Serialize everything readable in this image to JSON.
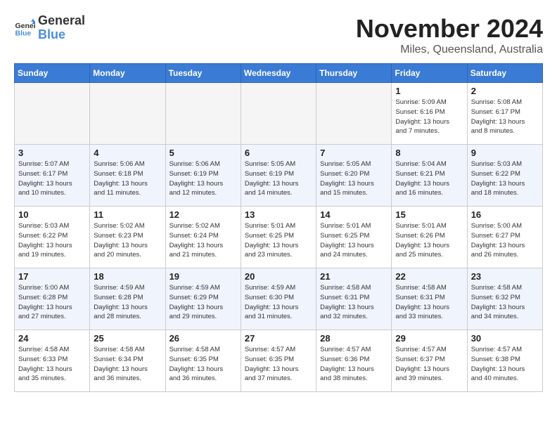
{
  "logo": {
    "general": "General",
    "blue": "Blue"
  },
  "header": {
    "month": "November 2024",
    "location": "Miles, Queensland, Australia"
  },
  "weekdays": [
    "Sunday",
    "Monday",
    "Tuesday",
    "Wednesday",
    "Thursday",
    "Friday",
    "Saturday"
  ],
  "weeks": [
    [
      {
        "day": "",
        "info": ""
      },
      {
        "day": "",
        "info": ""
      },
      {
        "day": "",
        "info": ""
      },
      {
        "day": "",
        "info": ""
      },
      {
        "day": "",
        "info": ""
      },
      {
        "day": "1",
        "info": "Sunrise: 5:09 AM\nSunset: 6:16 PM\nDaylight: 13 hours\nand 7 minutes."
      },
      {
        "day": "2",
        "info": "Sunrise: 5:08 AM\nSunset: 6:17 PM\nDaylight: 13 hours\nand 8 minutes."
      }
    ],
    [
      {
        "day": "3",
        "info": "Sunrise: 5:07 AM\nSunset: 6:17 PM\nDaylight: 13 hours\nand 10 minutes."
      },
      {
        "day": "4",
        "info": "Sunrise: 5:06 AM\nSunset: 6:18 PM\nDaylight: 13 hours\nand 11 minutes."
      },
      {
        "day": "5",
        "info": "Sunrise: 5:06 AM\nSunset: 6:19 PM\nDaylight: 13 hours\nand 12 minutes."
      },
      {
        "day": "6",
        "info": "Sunrise: 5:05 AM\nSunset: 6:19 PM\nDaylight: 13 hours\nand 14 minutes."
      },
      {
        "day": "7",
        "info": "Sunrise: 5:05 AM\nSunset: 6:20 PM\nDaylight: 13 hours\nand 15 minutes."
      },
      {
        "day": "8",
        "info": "Sunrise: 5:04 AM\nSunset: 6:21 PM\nDaylight: 13 hours\nand 16 minutes."
      },
      {
        "day": "9",
        "info": "Sunrise: 5:03 AM\nSunset: 6:22 PM\nDaylight: 13 hours\nand 18 minutes."
      }
    ],
    [
      {
        "day": "10",
        "info": "Sunrise: 5:03 AM\nSunset: 6:22 PM\nDaylight: 13 hours\nand 19 minutes."
      },
      {
        "day": "11",
        "info": "Sunrise: 5:02 AM\nSunset: 6:23 PM\nDaylight: 13 hours\nand 20 minutes."
      },
      {
        "day": "12",
        "info": "Sunrise: 5:02 AM\nSunset: 6:24 PM\nDaylight: 13 hours\nand 21 minutes."
      },
      {
        "day": "13",
        "info": "Sunrise: 5:01 AM\nSunset: 6:25 PM\nDaylight: 13 hours\nand 23 minutes."
      },
      {
        "day": "14",
        "info": "Sunrise: 5:01 AM\nSunset: 6:25 PM\nDaylight: 13 hours\nand 24 minutes."
      },
      {
        "day": "15",
        "info": "Sunrise: 5:01 AM\nSunset: 6:26 PM\nDaylight: 13 hours\nand 25 minutes."
      },
      {
        "day": "16",
        "info": "Sunrise: 5:00 AM\nSunset: 6:27 PM\nDaylight: 13 hours\nand 26 minutes."
      }
    ],
    [
      {
        "day": "17",
        "info": "Sunrise: 5:00 AM\nSunset: 6:28 PM\nDaylight: 13 hours\nand 27 minutes."
      },
      {
        "day": "18",
        "info": "Sunrise: 4:59 AM\nSunset: 6:28 PM\nDaylight: 13 hours\nand 28 minutes."
      },
      {
        "day": "19",
        "info": "Sunrise: 4:59 AM\nSunset: 6:29 PM\nDaylight: 13 hours\nand 29 minutes."
      },
      {
        "day": "20",
        "info": "Sunrise: 4:59 AM\nSunset: 6:30 PM\nDaylight: 13 hours\nand 31 minutes."
      },
      {
        "day": "21",
        "info": "Sunrise: 4:58 AM\nSunset: 6:31 PM\nDaylight: 13 hours\nand 32 minutes."
      },
      {
        "day": "22",
        "info": "Sunrise: 4:58 AM\nSunset: 6:31 PM\nDaylight: 13 hours\nand 33 minutes."
      },
      {
        "day": "23",
        "info": "Sunrise: 4:58 AM\nSunset: 6:32 PM\nDaylight: 13 hours\nand 34 minutes."
      }
    ],
    [
      {
        "day": "24",
        "info": "Sunrise: 4:58 AM\nSunset: 6:33 PM\nDaylight: 13 hours\nand 35 minutes."
      },
      {
        "day": "25",
        "info": "Sunrise: 4:58 AM\nSunset: 6:34 PM\nDaylight: 13 hours\nand 36 minutes."
      },
      {
        "day": "26",
        "info": "Sunrise: 4:58 AM\nSunset: 6:35 PM\nDaylight: 13 hours\nand 36 minutes."
      },
      {
        "day": "27",
        "info": "Sunrise: 4:57 AM\nSunset: 6:35 PM\nDaylight: 13 hours\nand 37 minutes."
      },
      {
        "day": "28",
        "info": "Sunrise: 4:57 AM\nSunset: 6:36 PM\nDaylight: 13 hours\nand 38 minutes."
      },
      {
        "day": "29",
        "info": "Sunrise: 4:57 AM\nSunset: 6:37 PM\nDaylight: 13 hours\nand 39 minutes."
      },
      {
        "day": "30",
        "info": "Sunrise: 4:57 AM\nSunset: 6:38 PM\nDaylight: 13 hours\nand 40 minutes."
      }
    ]
  ]
}
